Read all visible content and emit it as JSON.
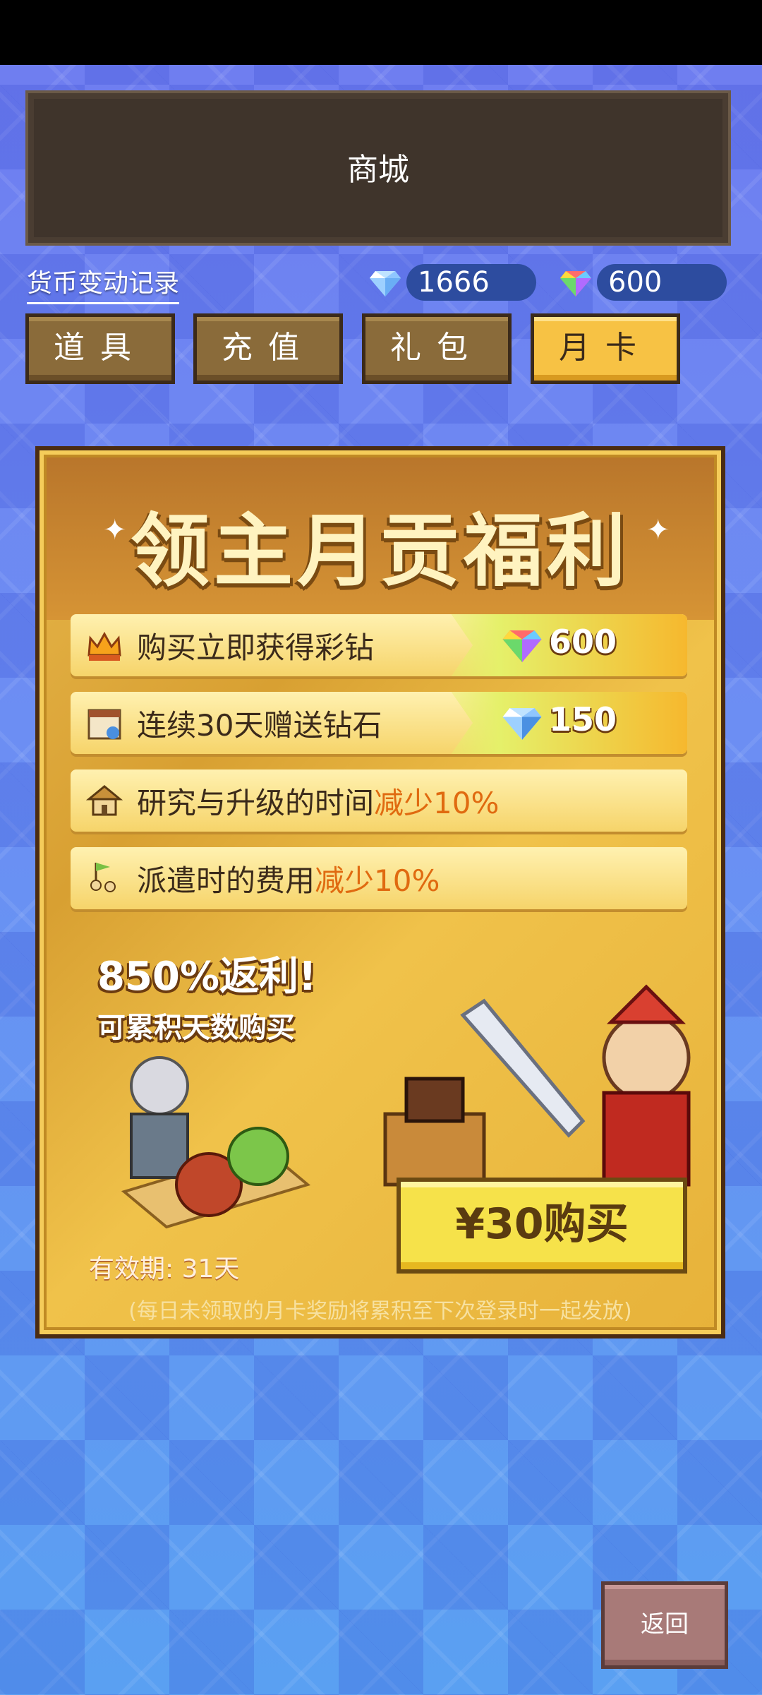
{
  "header": {
    "title": "商城"
  },
  "wallet": {
    "history_link": "货币变动记录",
    "diamond": "1666",
    "rainbow_diamond": "600"
  },
  "tabs": [
    {
      "label": "道具",
      "active": false
    },
    {
      "label": "充值",
      "active": false
    },
    {
      "label": "礼包",
      "active": false
    },
    {
      "label": "月卡",
      "active": true
    }
  ],
  "card": {
    "title": "领主月贡福利",
    "benefits": [
      {
        "text": "购买立即获得彩钻",
        "highlight": "",
        "amount": "600",
        "icon": "crown-icon",
        "amount_icon": "rainbow-gem-icon"
      },
      {
        "text": "连续30天赠送钻石",
        "highlight": "",
        "amount": "150",
        "icon": "calendar-icon",
        "amount_icon": "diamond-icon"
      },
      {
        "text": "研究与升级的时间",
        "highlight": "减少10%",
        "icon": "house-upgrade-icon"
      },
      {
        "text": "派遣时的费用",
        "highlight": "减少10%",
        "icon": "dispatch-flag-icon"
      }
    ],
    "rebate_big": "850%返利!",
    "rebate_small": "可累积天数购买",
    "validity": "有效期: 31天",
    "buy_label": "¥30购买",
    "note": "(每日未领取的月卡奖励将累积至下次登录时一起发放)"
  },
  "footer": {
    "back_label": "返回"
  },
  "colors": {
    "accent_gold": "#f7c244",
    "brown": "#3f342b",
    "highlight_orange": "#e06a10"
  }
}
